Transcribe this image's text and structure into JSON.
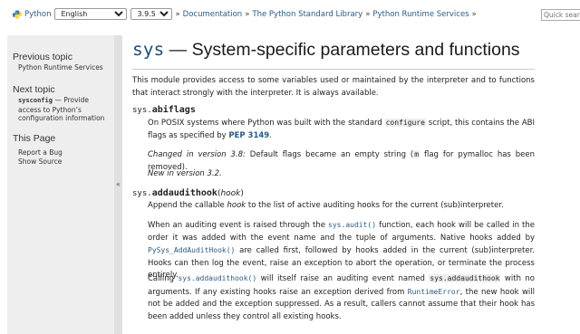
{
  "nav": {
    "brand": "Python",
    "language": "English",
    "version": "3.9.5",
    "breadcrumbs": [
      "Documentation",
      "The Python Standard Library",
      "Python Runtime Services"
    ],
    "sep": "»",
    "search_placeholder": "Quick search"
  },
  "sidebar": {
    "previous_heading": "Previous topic",
    "previous_link": "Python Runtime Services",
    "next_heading": "Next topic",
    "next_link": "sysconfig",
    "next_desc": " — Provide access to Python’s configuration information",
    "page_heading": "This Page",
    "report_bug": "Report a Bug",
    "show_source": "Show Source",
    "collapse_glyph": "«"
  },
  "page": {
    "title_mono": "sys",
    "title_text": " — System-specific parameters and functions",
    "intro": "This module provides access to some variables used or maintained by the interpreter and to functions that interact strongly with the interpreter. It is always available."
  },
  "abiflags": {
    "prefix": "sys.",
    "name": "abiflags",
    "p1_a": "On POSIX systems where Python was built with the standard ",
    "p1_code": "configure",
    "p1_b": " script, this contains the ABI flags as specified by ",
    "p1_pep": "PEP 3149",
    "p1_c": ".",
    "changed_label": "Changed in version 3.8:",
    "changed_a": " Default flags became an empty string (",
    "changed_code": "m",
    "changed_b": " flag for pymalloc has been removed).",
    "new_label": "New in version 3.2."
  },
  "addaudithook": {
    "prefix": "sys.",
    "name": "addaudithook",
    "open": "(",
    "param": "hook",
    "close": ")",
    "p1_a": "Append the callable ",
    "p1_em": "hook",
    "p1_b": " to the list of active auditing hooks for the current (sub)interpreter.",
    "p2_a": "When an auditing event is raised through the ",
    "p2_code1": "sys.audit()",
    "p2_b": " function, each hook will be called in the order it was added with the event name and the tuple of arguments. Native hooks added by ",
    "p2_code2": "PySys_AddAuditHook()",
    "p2_c": " are called first, followed by hooks added in the current (sub)interpreter. Hooks can then log the event, raise an exception to abort the operation, or terminate the process entirely.",
    "p3_a": "Calling ",
    "p3_code1": "sys.addaudithook()",
    "p3_b": " will itself raise an auditing event named ",
    "p3_code2": "sys.addaudithook",
    "p3_c": " with no arguments. If any existing hooks raise an exception derived from ",
    "p3_code3": "RuntimeError",
    "p3_d": ", the new hook will not be added and the exception suppressed. As a result, callers cannot assume that their hook has been added unless they control all existing hooks."
  }
}
